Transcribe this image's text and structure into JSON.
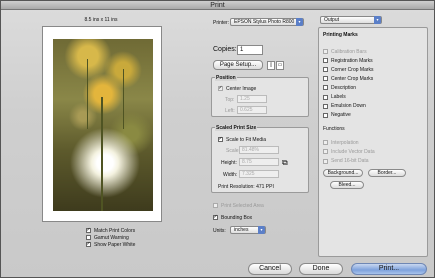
{
  "window": {
    "title": "Print"
  },
  "preview": {
    "paper_size_label": "8.5 ins x 11 ins"
  },
  "left_options": [
    {
      "label": "Match Print Colors",
      "checked": true
    },
    {
      "label": "Gamut Warning",
      "checked": false
    },
    {
      "label": "Show Paper White",
      "checked": true
    }
  ],
  "printer": {
    "label": "Printer:",
    "value": "EPSON Stylus Photo R800"
  },
  "copies": {
    "label": "Copies:",
    "value": "1"
  },
  "page_setup": {
    "label": "Page Setup..."
  },
  "position": {
    "title": "Position",
    "center_image": "Center Image",
    "top_label": "Top:",
    "top_value": "1.25",
    "left_label": "Left:",
    "left_value": "0.625"
  },
  "scaled": {
    "title": "Scaled Print Size",
    "scale_to_fit": "Scale to Fit Media",
    "scale_label": "Scale:",
    "scale_value": "81.48%",
    "height_label": "Height:",
    "height_value": "8.75",
    "width_label": "Width:",
    "width_value": "7.325",
    "resolution": "Print Resolution: 471 PPI"
  },
  "print_selected_area": "Print Selected Area",
  "bounding_box": "Bounding Box",
  "units": {
    "label": "Units:",
    "value": "inches"
  },
  "output": {
    "popup_value": "Output",
    "marks_title": "Printing Marks",
    "marks": [
      {
        "label": "Calibration Bars",
        "checked": false,
        "enabled": false
      },
      {
        "label": "Registration Marks",
        "checked": false,
        "enabled": true
      },
      {
        "label": "Corner Crop Marks",
        "checked": false,
        "enabled": true
      },
      {
        "label": "Center Crop Marks",
        "checked": false,
        "enabled": true
      },
      {
        "label": "Description",
        "checked": false,
        "enabled": true
      },
      {
        "label": "Labels",
        "checked": false,
        "enabled": true
      },
      {
        "label": "Emulsion Down",
        "checked": false,
        "enabled": true
      },
      {
        "label": "Negative",
        "checked": false,
        "enabled": true
      }
    ],
    "functions_title": "Functions",
    "functions": [
      {
        "label": "Interpolation",
        "checked": false,
        "enabled": false
      },
      {
        "label": "Include Vector Data",
        "checked": false,
        "enabled": false
      },
      {
        "label": "Send 16-bit Data",
        "checked": false,
        "enabled": false
      }
    ],
    "background_btn": "Background...",
    "border_btn": "Border...",
    "bleed_btn": "Bleed..."
  },
  "buttons": {
    "cancel": "Cancel",
    "done": "Done",
    "print": "Print..."
  }
}
